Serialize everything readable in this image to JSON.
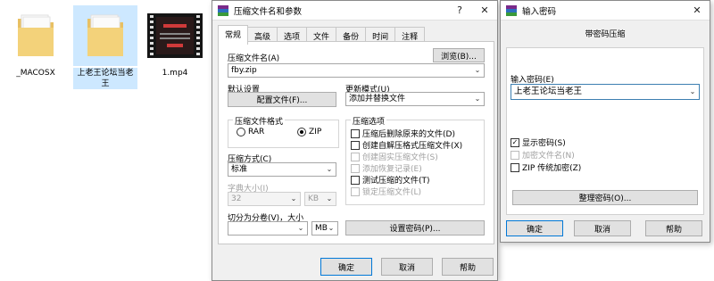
{
  "desktop": {
    "files": [
      {
        "name": "_MACOSX",
        "type": "folder"
      },
      {
        "name": "上老王论坛当老王",
        "type": "folder"
      },
      {
        "name": "1.mp4",
        "type": "video"
      }
    ]
  },
  "compress_dialog": {
    "title": "压缩文件名和参数",
    "help_btn": "?",
    "close_btn": "✕",
    "tabs": [
      "常规",
      "高级",
      "选项",
      "文件",
      "备份",
      "时间",
      "注释"
    ],
    "archive_name_label": "压缩文件名(A)",
    "browse_button": "浏览(B)...",
    "archive_name_value": "fby.zip",
    "default_settings_label": "默认设置",
    "profiles_button": "配置文件(F)...",
    "update_mode_label": "更新模式(U)",
    "update_mode_value": "添加并替换文件",
    "format_group_title": "压缩文件格式",
    "format_rar": "RAR",
    "format_zip": "ZIP",
    "options_group_title": "压缩选项",
    "options": [
      {
        "label": "压缩后删除原来的文件(D)",
        "checked": false,
        "disabled": false
      },
      {
        "label": "创建自解压格式压缩文件(X)",
        "checked": false,
        "disabled": false
      },
      {
        "label": "创建固实压缩文件(S)",
        "checked": false,
        "disabled": true
      },
      {
        "label": "添加恢复记录(E)",
        "checked": false,
        "disabled": true
      },
      {
        "label": "测试压缩的文件(T)",
        "checked": false,
        "disabled": false
      },
      {
        "label": "锁定压缩文件(L)",
        "checked": false,
        "disabled": true
      }
    ],
    "method_label": "压缩方式(C)",
    "method_value": "标准",
    "dict_size_label": "字典大小(I)",
    "dict_size_value": "32",
    "dict_unit": "KB",
    "split_label": "切分为分卷(V)，大小",
    "split_value": "",
    "split_unit": "MB",
    "set_password_button": "设置密码(P)...",
    "ok_button": "确定",
    "cancel_button": "取消",
    "help_button": "帮助"
  },
  "password_dialog": {
    "title": "输入密码",
    "close_btn": "✕",
    "heading": "带密码压缩",
    "input_label": "输入密码(E)",
    "password_value": "上老王论坛当老王",
    "show_password": "显示密码(S)",
    "encrypt_filenames": "加密文件名(N)",
    "zip_legacy": "ZIP 传统加密(Z)",
    "organize_button": "整理密码(O)...",
    "ok_button": "确定",
    "cancel_button": "取消",
    "help_button": "帮助"
  }
}
